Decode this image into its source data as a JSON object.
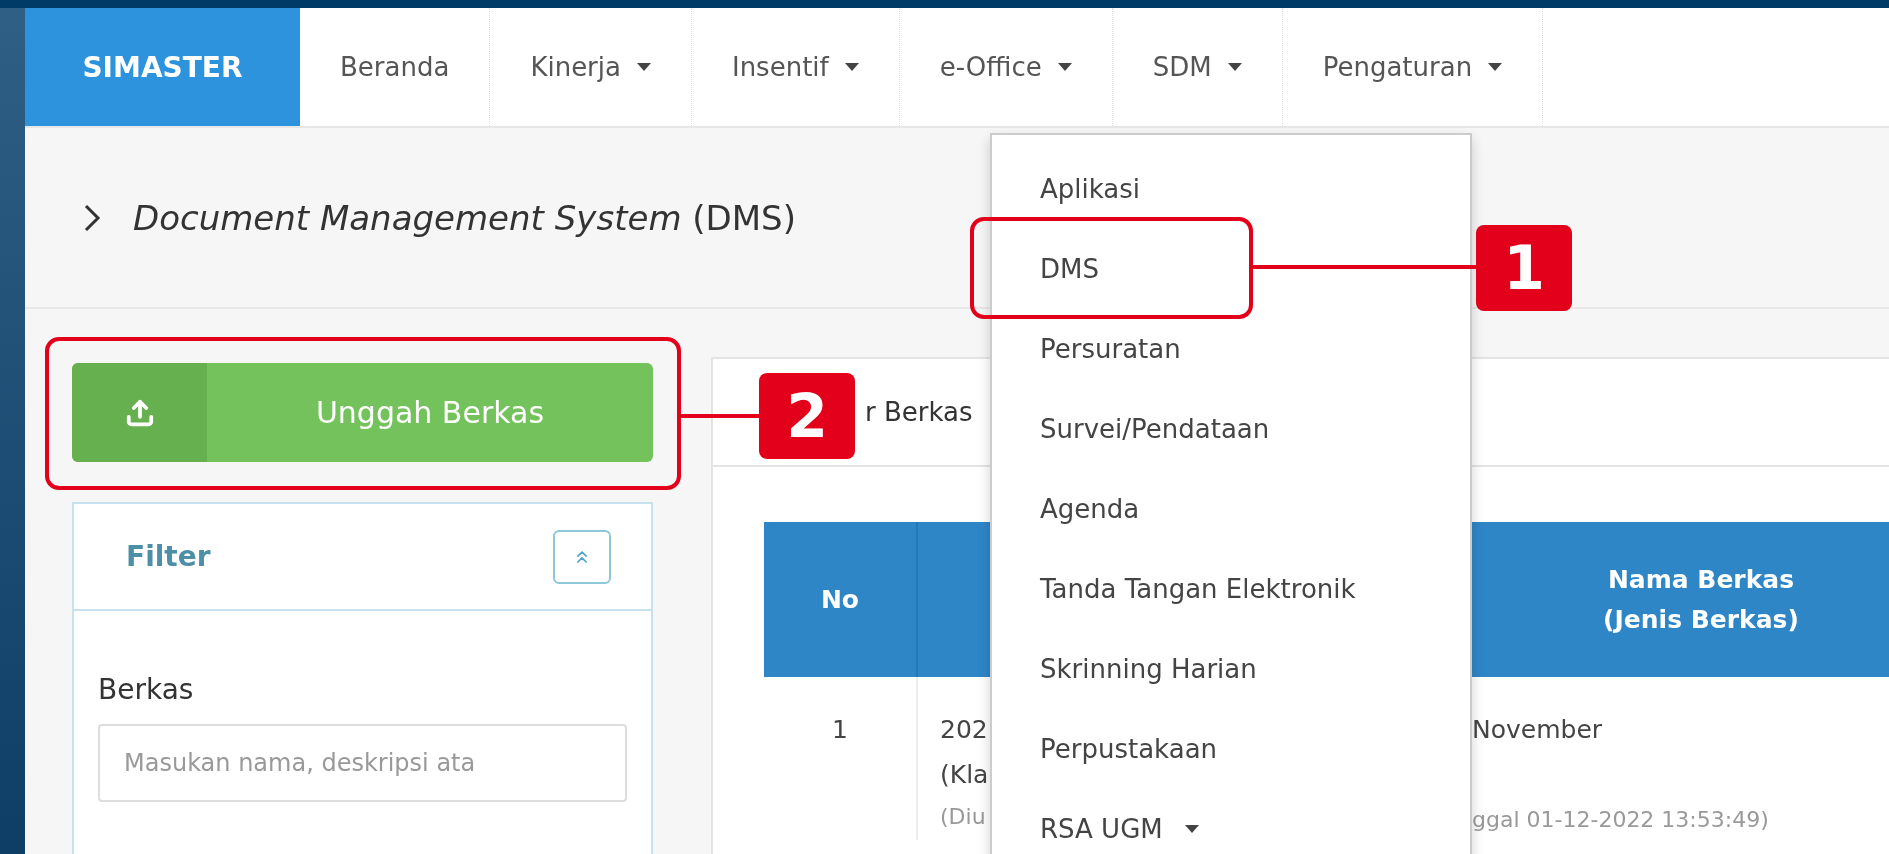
{
  "brand": "SIMASTER",
  "nav": [
    {
      "label": "Beranda",
      "has_caret": false
    },
    {
      "label": "Kinerja",
      "has_caret": true
    },
    {
      "label": "Insentif",
      "has_caret": true
    },
    {
      "label": "e-Office",
      "has_caret": true
    },
    {
      "label": "SDM",
      "has_caret": true
    },
    {
      "label": "Pengaturan",
      "has_caret": true
    }
  ],
  "page_title": "*Document Management System* (DMS)",
  "upload_button": "Unggah Berkas",
  "filter": {
    "title": "Filter",
    "expanded": true,
    "field_label": "Berkas",
    "placeholder": "Masukan nama, deskripsi ata"
  },
  "panel": {
    "header_text": "r Berkas",
    "table": {
      "headers": {
        "no": "No",
        "name": [
          "Nama Berkas",
          "(Jenis Berkas)"
        ]
      },
      "rows": [
        {
          "no": "1",
          "column_2": [
            "202",
            "(Kla"
          ],
          "column_2_note": "(Diu",
          "name": "November",
          "name_note": "ggal 01-12-2022 13:53:49)"
        }
      ]
    }
  },
  "dropdown_menu": [
    {
      "label": "Aplikasi",
      "has_caret": false
    },
    {
      "label": "DMS",
      "has_caret": false
    },
    {
      "label": "Persuratan",
      "has_caret": false
    },
    {
      "label": "Survei/Pendataan",
      "has_caret": false
    },
    {
      "label": "Agenda",
      "has_caret": false
    },
    {
      "label": "Tanda Tangan Elektronik",
      "has_caret": false
    },
    {
      "label": "Skrinning Harian",
      "has_caret": false
    },
    {
      "label": "Perpustakaan",
      "has_caret": false
    },
    {
      "label": "RSA UGM",
      "has_caret": true
    }
  ],
  "callouts": [
    {
      "number": "1"
    },
    {
      "number": "2"
    }
  ]
}
